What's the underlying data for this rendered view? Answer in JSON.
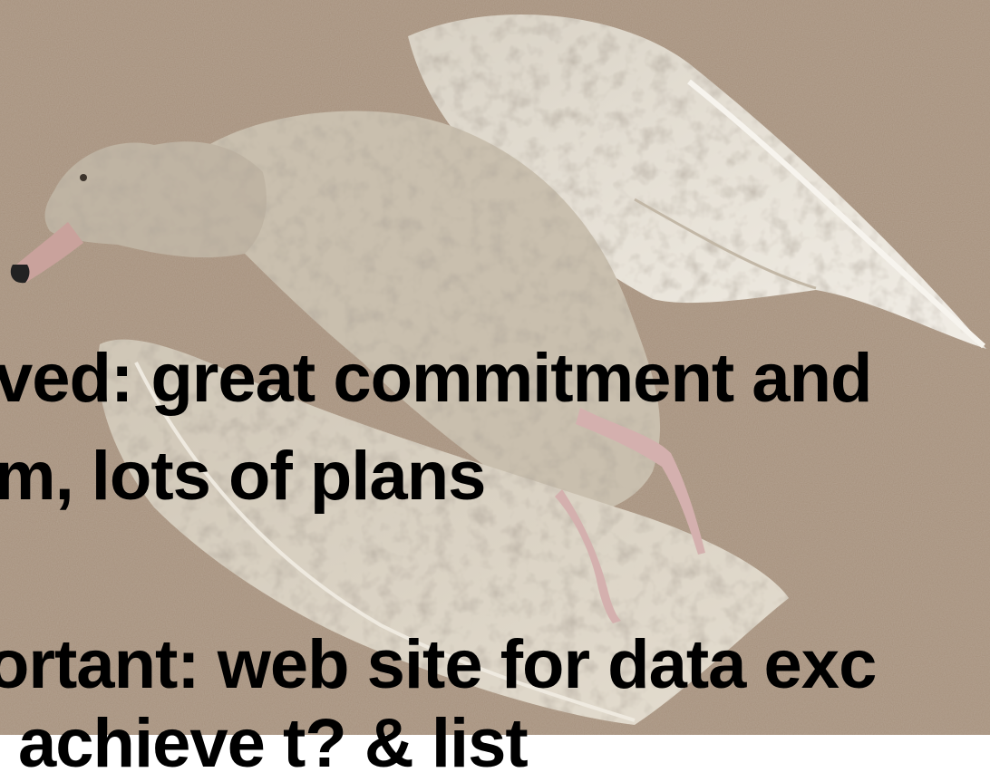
{
  "colors": {
    "sand": "#9a8470",
    "sand_light": "#b09a85",
    "feather_light": "#e6e0d4",
    "feather_mottled": "#8f8170",
    "text": "#000000"
  },
  "overlay_text": {
    "line1": "ved: great commitment and",
    "line2": "m, lots of plans",
    "line3": "ortant: web site for data exc",
    "line4": "achieve t? & list"
  }
}
